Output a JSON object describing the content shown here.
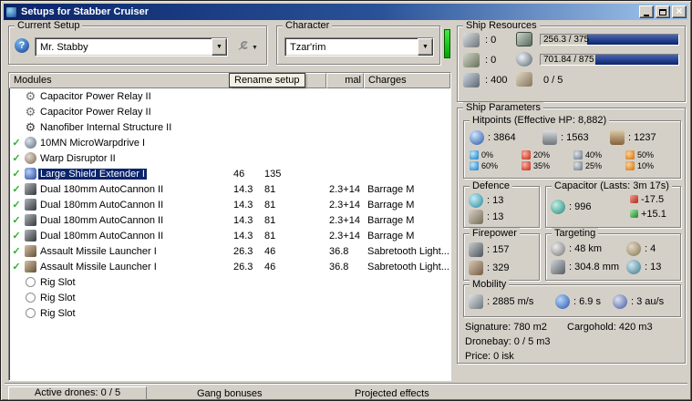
{
  "window": {
    "title": "Setups for Stabber Cruiser",
    "controls": [
      "minimize-icon",
      "maximize-icon",
      "close-icon"
    ]
  },
  "current_setup": {
    "label": "Current Setup",
    "value": "Mr. Stabby"
  },
  "character": {
    "label": "Character",
    "value": "Tzar'rim"
  },
  "modules_panel": {
    "header": {
      "name": "Modules",
      "optimal": "mal",
      "charges": "Charges"
    },
    "tooltip": "Rename setup",
    "rows": [
      {
        "checked": false,
        "icon": "gear-icon",
        "name": "Capacitor Power Relay II",
        "cpu": "",
        "pg": "",
        "optimal": "",
        "charge": "",
        "selected": false
      },
      {
        "checked": false,
        "icon": "gear-icon",
        "name": "Capacitor Power Relay II",
        "cpu": "",
        "pg": "",
        "optimal": "",
        "charge": "",
        "selected": false
      },
      {
        "checked": false,
        "icon": "gear-dark-icon",
        "name": "Nanofiber Internal Structure II",
        "cpu": "",
        "pg": "",
        "optimal": "",
        "charge": "",
        "selected": false
      },
      {
        "checked": true,
        "icon": "mwd-icon",
        "name": "10MN MicroWarpdrive I",
        "cpu": "",
        "pg": "",
        "optimal": "",
        "charge": "",
        "selected": false
      },
      {
        "checked": true,
        "icon": "disruptor-icon",
        "name": "Warp Disruptor II",
        "cpu": "",
        "pg": "",
        "optimal": "",
        "charge": "",
        "selected": false
      },
      {
        "checked": true,
        "icon": "shield-extender-icon",
        "name": "Large Shield Extender I",
        "cpu": "46",
        "pg": "135",
        "optimal": "",
        "charge": "",
        "selected": true
      },
      {
        "checked": true,
        "icon": "autocannon-icon",
        "name": "Dual 180mm AutoCannon II",
        "cpu": "14.3",
        "pg": "81",
        "optimal": "2.3+14",
        "charge": "Barrage M",
        "selected": false
      },
      {
        "checked": true,
        "icon": "autocannon-icon",
        "name": "Dual 180mm AutoCannon II",
        "cpu": "14.3",
        "pg": "81",
        "optimal": "2.3+14",
        "charge": "Barrage M",
        "selected": false
      },
      {
        "checked": true,
        "icon": "autocannon-icon",
        "name": "Dual 180mm AutoCannon II",
        "cpu": "14.3",
        "pg": "81",
        "optimal": "2.3+14",
        "charge": "Barrage M",
        "selected": false
      },
      {
        "checked": true,
        "icon": "autocannon-icon",
        "name": "Dual 180mm AutoCannon II",
        "cpu": "14.3",
        "pg": "81",
        "optimal": "2.3+14",
        "charge": "Barrage M",
        "selected": false
      },
      {
        "checked": true,
        "icon": "launcher-icon",
        "name": "Assault Missile Launcher I",
        "cpu": "26.3",
        "pg": "46",
        "optimal": "36.8",
        "charge": "Sabretooth Light...",
        "selected": false
      },
      {
        "checked": true,
        "icon": "launcher-icon",
        "name": "Assault Missile Launcher I",
        "cpu": "26.3",
        "pg": "46",
        "optimal": "36.8",
        "charge": "Sabretooth Light...",
        "selected": false
      },
      {
        "checked": false,
        "icon": "rig-slot-icon",
        "name": "Rig Slot",
        "cpu": "",
        "pg": "",
        "optimal": "",
        "charge": "",
        "selected": false
      },
      {
        "checked": false,
        "icon": "rig-slot-icon",
        "name": "Rig Slot",
        "cpu": "",
        "pg": "",
        "optimal": "",
        "charge": "",
        "selected": false
      },
      {
        "checked": false,
        "icon": "rig-slot-icon",
        "name": "Rig Slot",
        "cpu": "",
        "pg": "",
        "optimal": "",
        "charge": "",
        "selected": false
      }
    ]
  },
  "ship_resources": {
    "label": "Ship Resources",
    "slots": [
      {
        "icon": "turret-hardpoint-icon",
        "value": ": 0"
      },
      {
        "icon": "launcher-hardpoint-icon",
        "value": ": 0"
      },
      {
        "icon": "drone-capacity-icon",
        "value": ": 400"
      }
    ],
    "bars": [
      {
        "icon": "cpu-icon",
        "text": "256.3 / 375",
        "fill_pct": 66
      },
      {
        "icon": "powergrid-icon",
        "text": "701.84 / 875",
        "fill_pct": 60
      },
      {
        "icon": "rig-calibration-icon",
        "text": "0 / 5",
        "fill_pct": 0
      }
    ]
  },
  "ship_parameters": {
    "label": "Ship Parameters",
    "hitpoints": {
      "label": "Hitpoints (Effective HP: 8,882)",
      "pools": [
        {
          "icon": "shield-hp-icon",
          "value": ": 3864"
        },
        {
          "icon": "armor-hp-icon",
          "value": ": 1563"
        },
        {
          "icon": "structure-hp-icon",
          "value": ": 1237"
        }
      ],
      "resists": [
        {
          "icon": "em-resist-icon",
          "shield": "0%",
          "armor": "60%"
        },
        {
          "icon": "thermal-resist-icon",
          "shield": "20%",
          "armor": "35%"
        },
        {
          "icon": "kinetic-resist-icon",
          "shield": "40%",
          "armor": "25%"
        },
        {
          "icon": "explosive-resist-icon",
          "shield": "50%",
          "armor": "10%"
        }
      ]
    },
    "defence": {
      "label": "Defence",
      "rows": [
        {
          "icon": "shield-recharge-icon",
          "value": ": 13"
        },
        {
          "icon": "armor-defence-icon",
          "value": ": 13"
        }
      ]
    },
    "capacitor": {
      "label": "Capacitor (Lasts: 3m 17s)",
      "amount": ": 996",
      "usage": "-17.5",
      "recharge": "+15.1"
    },
    "firepower": {
      "label": "Firepower",
      "rows": [
        {
          "icon": "turret-damage-icon",
          "value": ": 157"
        },
        {
          "icon": "missile-damage-icon",
          "value": ": 329"
        }
      ]
    },
    "targeting": {
      "label": "Targeting",
      "cells": [
        {
          "icon": "targeting-range-icon",
          "value": ": 48 km"
        },
        {
          "icon": "max-targets-icon",
          "value": ": 4"
        },
        {
          "icon": "scan-resolution-icon",
          "value": ": 304.8 mm"
        },
        {
          "icon": "sensor-strength-icon",
          "value": ": 13"
        }
      ]
    },
    "mobility": {
      "label": "Mobility",
      "cells": [
        {
          "icon": "max-velocity-icon",
          "value": ": 2885 m/s"
        },
        {
          "icon": "align-time-icon",
          "value": ": 6.9 s"
        },
        {
          "icon": "warp-speed-icon",
          "value": ": 3 au/s"
        }
      ]
    },
    "summary": {
      "signature": "Signature: 780 m2",
      "cargohold": "Cargohold: 420 m3",
      "dronebay": "Dronebay: 0 / 5 m3",
      "price": "Price: 0 isk"
    }
  },
  "bottom_bar": {
    "active_drones": "Active drones: 0 / 5",
    "gang_bonuses": "Gang bonuses",
    "projected_effects": "Projected effects"
  }
}
